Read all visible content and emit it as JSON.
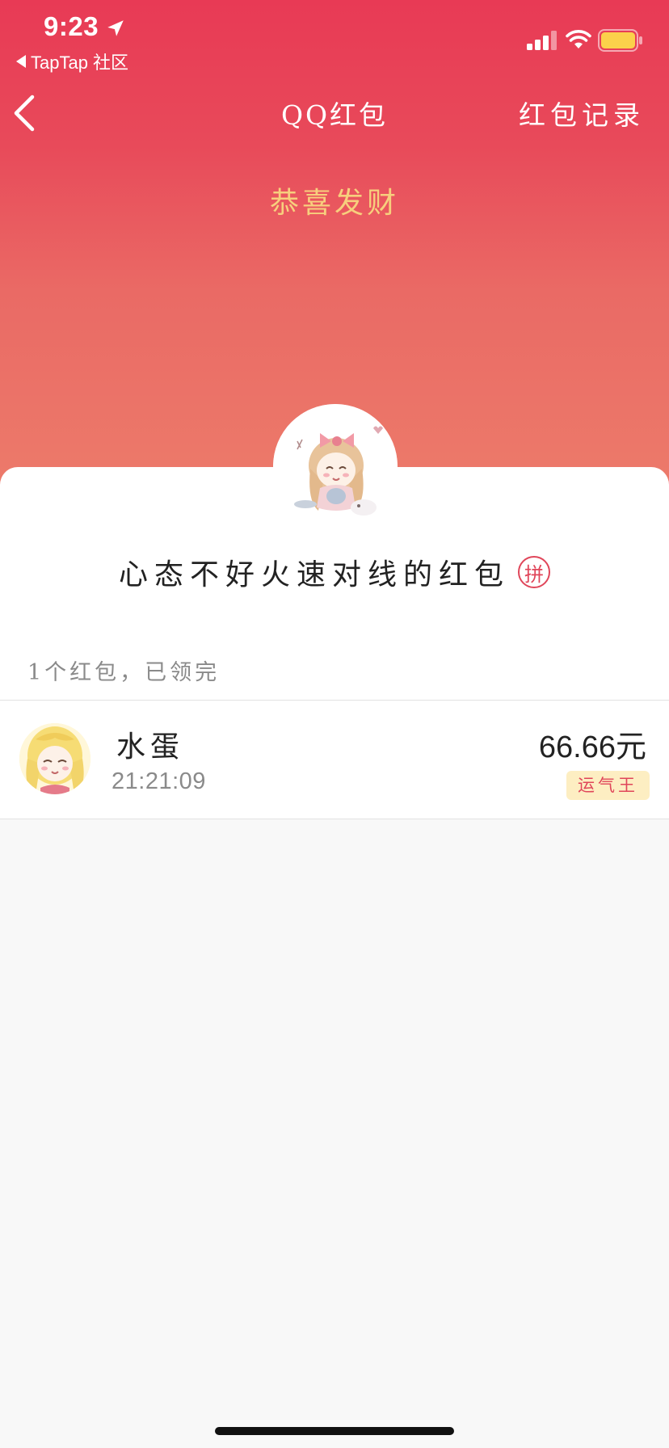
{
  "status_bar": {
    "time": "9:23",
    "back_app": "TapTap 社区"
  },
  "nav": {
    "title": "QQ红包",
    "records_label": "红包记录"
  },
  "greeting": "恭喜发财",
  "packet": {
    "title": "心态不好火速对线的红包",
    "badge": "拼",
    "summary": "1个红包，已领完"
  },
  "recipients": [
    {
      "name": "水蛋",
      "time": "21:21:09",
      "amount": "66.66元",
      "badge": "运气王"
    }
  ],
  "colors": {
    "header_top": "#e83a55",
    "header_bottom": "#ec7a6a",
    "greeting": "#f7cf7d",
    "accent_red": "#e0465a",
    "badge_bg": "#fdeec2"
  },
  "icons": [
    "location-arrow-icon",
    "back-triangle-icon",
    "signal-icon",
    "wifi-icon",
    "battery-icon",
    "chevron-left-icon"
  ]
}
